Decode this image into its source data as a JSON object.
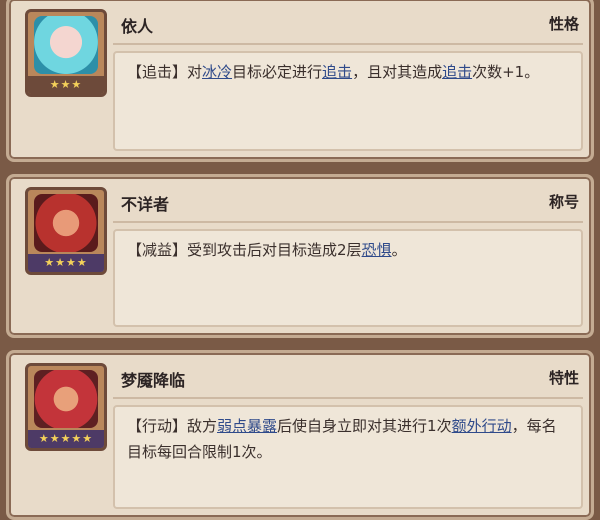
{
  "cards": [
    {
      "name": "依人",
      "tag": "性格",
      "stars": "★★★",
      "desc": [
        {
          "t": "【追击】对",
          "kw": false
        },
        {
          "t": "冰冷",
          "kw": true
        },
        {
          "t": "目标必定进行",
          "kw": false
        },
        {
          "t": "追击",
          "kw": true
        },
        {
          "t": "，且对其造成",
          "kw": false
        },
        {
          "t": "追击",
          "kw": true
        },
        {
          "t": "次数+1。",
          "kw": false
        }
      ]
    },
    {
      "name": "不详者",
      "tag": "称号",
      "stars": "★★★★",
      "desc": [
        {
          "t": "【减益】受到攻击后对目标造成2层",
          "kw": false
        },
        {
          "t": "恐惧",
          "kw": true
        },
        {
          "t": "。",
          "kw": false
        }
      ]
    },
    {
      "name": "梦魇降临",
      "tag": "特性",
      "stars": "★★★★★",
      "desc": [
        {
          "t": "【行动】敌方",
          "kw": false
        },
        {
          "t": "弱点暴露",
          "kw": true
        },
        {
          "t": "后使自身立即对其进行1次",
          "kw": false
        },
        {
          "t": "额外行动",
          "kw": true
        },
        {
          "t": "，每名目标每回合限制1次。",
          "kw": false
        }
      ]
    }
  ],
  "icons": [
    "character-portrait-icon",
    "star-icon"
  ]
}
